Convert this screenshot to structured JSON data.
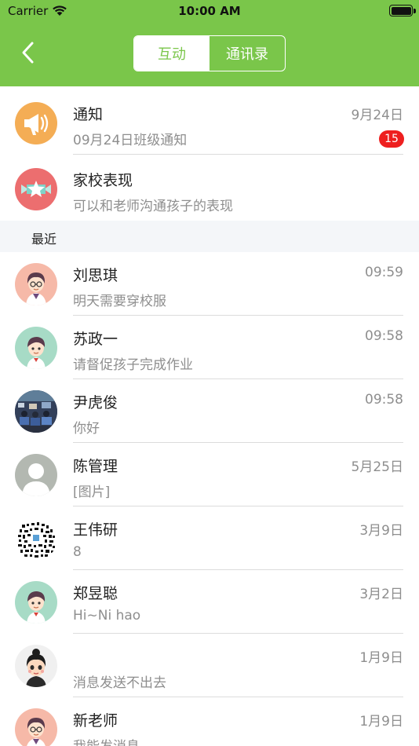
{
  "status_bar": {
    "carrier": "Carrier",
    "time": "10:00 AM"
  },
  "nav": {
    "tabs": [
      {
        "label": "互动",
        "active": true
      },
      {
        "label": "通讯录",
        "active": false
      }
    ]
  },
  "colors": {
    "header": "#7ac64a",
    "badge": "#ee1f1f",
    "notice_avatar": "#f4ad55",
    "behavior_avatar": "#ec6e6f"
  },
  "pinned": [
    {
      "name": "通知",
      "message": "09月24日班级通知",
      "time": "9月24日",
      "badge": "15",
      "icon": "megaphone-icon"
    },
    {
      "name": "家校表现",
      "message": "可以和老师沟通孩子的表现",
      "icon": "star-ribbon-icon"
    }
  ],
  "section_title": "最近",
  "conversations": [
    {
      "name": "刘思琪",
      "message": "明天需要穿校服",
      "time": "09:59",
      "avatar": "teacher-female-avatar"
    },
    {
      "name": "苏政一",
      "message": "请督促孩子完成作业",
      "time": "09:58",
      "avatar": "student-boy-avatar"
    },
    {
      "name": "尹虎俊",
      "message": "你好",
      "time": "09:58",
      "avatar": "classroom-photo-avatar"
    },
    {
      "name": "陈管理",
      "message": "[图片]",
      "time": "5月25日",
      "avatar": "default-person-avatar"
    },
    {
      "name": "王伟研",
      "message": "8",
      "time": "3月9日",
      "avatar": "qr-code-avatar"
    },
    {
      "name": "郑昱聪",
      "message": "Hi~Ni hao",
      "time": "3月2日",
      "avatar": "student-boy-avatar"
    },
    {
      "name": "",
      "message": "消息发送不出去",
      "time": "1月9日",
      "avatar": "cartoon-girl-avatar"
    },
    {
      "name": "新老师",
      "message": "我能发消息",
      "time": "1月9日",
      "avatar": "teacher-female-avatar"
    }
  ]
}
